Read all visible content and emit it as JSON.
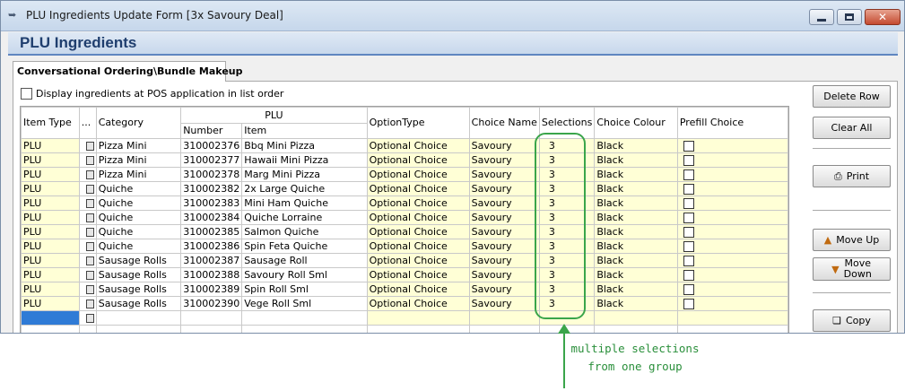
{
  "window": {
    "title": "PLU Ingredients Update Form [3x Savoury Deal]"
  },
  "header": {
    "title": "PLU Ingredients"
  },
  "tab": {
    "label": "Conversational Ordering\\Bundle Makeup"
  },
  "option": {
    "label": "Display ingredients at POS application in list order"
  },
  "grid": {
    "headers": {
      "item_type": "Item Type",
      "dots": "...",
      "category": "Category",
      "plu": "PLU",
      "number": "Number",
      "item": "Item",
      "option_type": "OptionType",
      "choice_name": "Choice Name",
      "selections": "Selections",
      "choice_colour": "Choice Colour",
      "prefill_choice": "Prefill Choice"
    },
    "rows": [
      {
        "item_type": "PLU",
        "category": "Pizza Mini",
        "number": "310002376",
        "item": "Bbq Mini Pizza",
        "option_type": "Optional Choice",
        "choice_name": "Savoury",
        "selections": "3",
        "choice_colour": "Black"
      },
      {
        "item_type": "PLU",
        "category": "Pizza Mini",
        "number": "310002377",
        "item": "Hawaii Mini Pizza",
        "option_type": "Optional Choice",
        "choice_name": "Savoury",
        "selections": "3",
        "choice_colour": "Black"
      },
      {
        "item_type": "PLU",
        "category": "Pizza Mini",
        "number": "310002378",
        "item": "Marg Mini Pizza",
        "option_type": "Optional Choice",
        "choice_name": "Savoury",
        "selections": "3",
        "choice_colour": "Black"
      },
      {
        "item_type": "PLU",
        "category": "Quiche",
        "number": "310002382",
        "item": "2x Large Quiche",
        "option_type": "Optional Choice",
        "choice_name": "Savoury",
        "selections": "3",
        "choice_colour": "Black"
      },
      {
        "item_type": "PLU",
        "category": "Quiche",
        "number": "310002383",
        "item": "Mini Ham Quiche",
        "option_type": "Optional Choice",
        "choice_name": "Savoury",
        "selections": "3",
        "choice_colour": "Black"
      },
      {
        "item_type": "PLU",
        "category": "Quiche",
        "number": "310002384",
        "item": "Quiche Lorraine",
        "option_type": "Optional Choice",
        "choice_name": "Savoury",
        "selections": "3",
        "choice_colour": "Black"
      },
      {
        "item_type": "PLU",
        "category": "Quiche",
        "number": "310002385",
        "item": "Salmon Quiche",
        "option_type": "Optional Choice",
        "choice_name": "Savoury",
        "selections": "3",
        "choice_colour": "Black"
      },
      {
        "item_type": "PLU",
        "category": "Quiche",
        "number": "310002386",
        "item": "Spin Feta Quiche",
        "option_type": "Optional Choice",
        "choice_name": "Savoury",
        "selections": "3",
        "choice_colour": "Black"
      },
      {
        "item_type": "PLU",
        "category": "Sausage Rolls",
        "number": "310002387",
        "item": "Sausage Roll",
        "option_type": "Optional Choice",
        "choice_name": "Savoury",
        "selections": "3",
        "choice_colour": "Black"
      },
      {
        "item_type": "PLU",
        "category": "Sausage Rolls",
        "number": "310002388",
        "item": "Savoury Roll Sml",
        "option_type": "Optional Choice",
        "choice_name": "Savoury",
        "selections": "3",
        "choice_colour": "Black"
      },
      {
        "item_type": "PLU",
        "category": "Sausage Rolls",
        "number": "310002389",
        "item": "Spin Roll Sml",
        "option_type": "Optional Choice",
        "choice_name": "Savoury",
        "selections": "3",
        "choice_colour": "Black"
      },
      {
        "item_type": "PLU",
        "category": "Sausage Rolls",
        "number": "310002390",
        "item": "Vege Roll Sml",
        "option_type": "Optional Choice",
        "choice_name": "Savoury",
        "selections": "3",
        "choice_colour": "Black"
      }
    ]
  },
  "buttons": {
    "delete_row": "Delete Row",
    "clear_all": "Clear All",
    "print": "Print",
    "move_up": "Move Up",
    "move_down_1": "Move",
    "move_down_2": "Down",
    "copy": "Copy"
  },
  "annotation": {
    "line1": "multiple selections",
    "line2": "from one group",
    "color": "#3aa54a"
  }
}
